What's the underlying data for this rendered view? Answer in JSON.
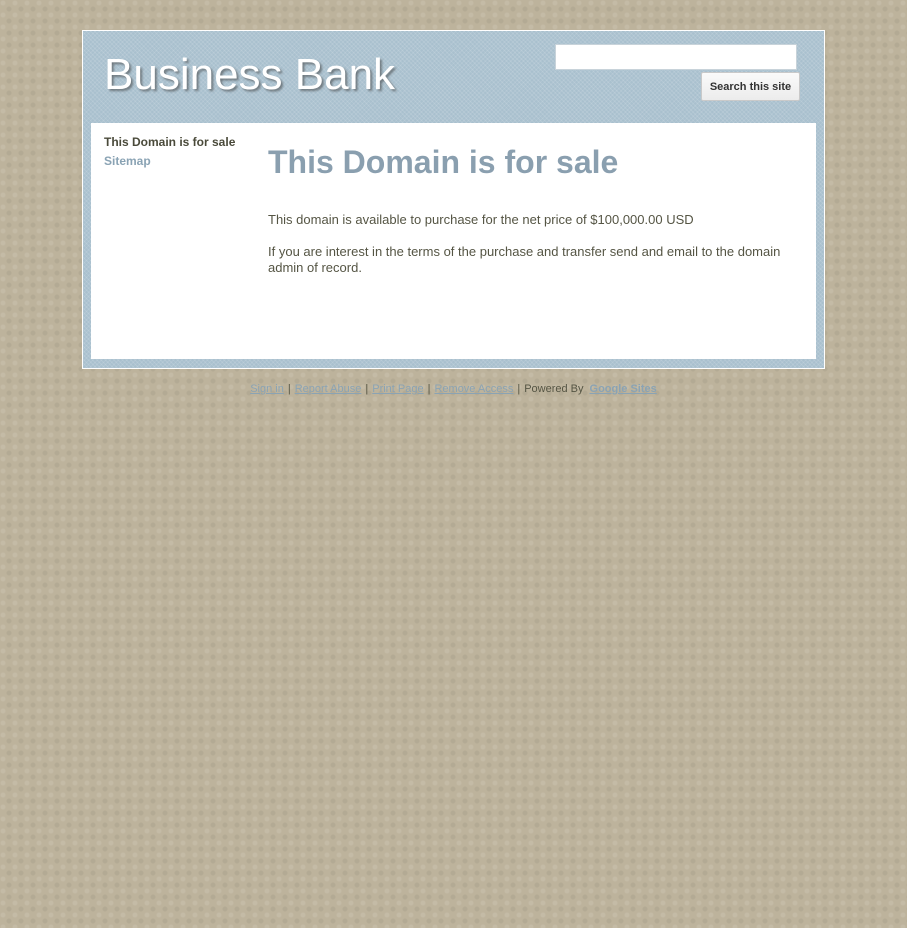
{
  "header": {
    "site_title": "Business Bank",
    "search_placeholder": "",
    "search_button_label": "Search this site"
  },
  "sidebar": {
    "items": [
      {
        "label": "This Domain is for sale",
        "current": true
      },
      {
        "label": "Sitemap",
        "current": false
      }
    ]
  },
  "main": {
    "page_title": "This Domain is for sale",
    "paragraphs": [
      "This domain is available to purchase for the net price of $100,000.00 USD",
      "If you are interest in the terms of the purchase and transfer send and email to the domain admin of record."
    ]
  },
  "footer": {
    "sign_in": "Sign in",
    "report_abuse": "Report Abuse",
    "print_page": "Print Page",
    "remove_access": "Remove Access",
    "separator": "|",
    "powered_by": "Powered By",
    "brand": "Google Sites"
  },
  "colors": {
    "page_background": "#bdb39c",
    "header_background": "#a9c0ce",
    "title_color": "#8a9faf",
    "link_color": "#8aa3b4",
    "text_color": "#555544"
  }
}
